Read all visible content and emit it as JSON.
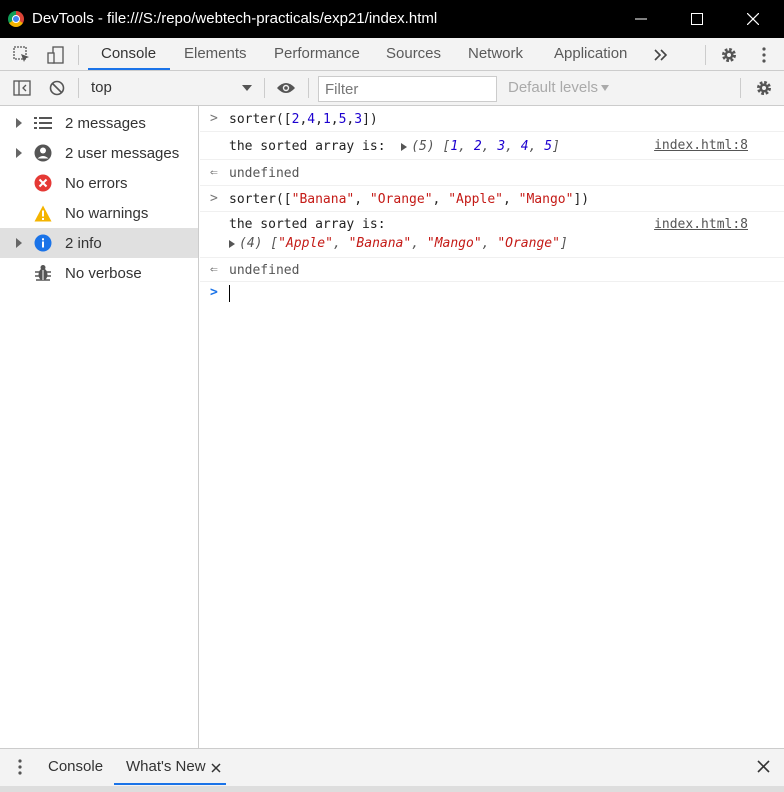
{
  "window": {
    "title": "DevTools - file:///S:/repo/webtech-practicals/exp21/index.html"
  },
  "tabs": [
    {
      "label": "Console",
      "active": true
    },
    {
      "label": "Elements"
    },
    {
      "label": "Performance"
    },
    {
      "label": "Sources"
    },
    {
      "label": "Network"
    },
    {
      "label": "Application"
    }
  ],
  "toolbar": {
    "context": "top",
    "filter_placeholder": "Filter",
    "levels": "Default levels"
  },
  "sidebar": {
    "items": [
      {
        "label": "2 messages",
        "icon": "list-icon"
      },
      {
        "label": "2 user messages",
        "icon": "user-icon"
      },
      {
        "label": "No errors",
        "icon": "error-icon"
      },
      {
        "label": "No warnings",
        "icon": "warning-icon"
      },
      {
        "label": "2 info",
        "icon": "info-icon",
        "selected": true
      },
      {
        "label": "No verbose",
        "icon": "bug-icon"
      }
    ]
  },
  "console": {
    "entries": [
      {
        "type": "input",
        "text": "sorter([2,4,1,5,3])"
      },
      {
        "type": "log",
        "text": "the sorted array is:",
        "preview": "(5) [1, 2, 3, 4, 5]",
        "source": "index.html:8"
      },
      {
        "type": "result",
        "text": "undefined"
      },
      {
        "type": "input",
        "text": "sorter([\"Banana\", \"Orange\", \"Apple\", \"Mango\"])"
      },
      {
        "type": "log",
        "text": "the sorted array is:",
        "preview": "(4) [\"Apple\", \"Banana\", \"Mango\", \"Orange\"]",
        "source": "index.html:8"
      },
      {
        "type": "result",
        "text": "undefined"
      }
    ]
  },
  "drawer": {
    "tabs": [
      {
        "label": "Console"
      },
      {
        "label": "What's New",
        "active": true
      }
    ]
  },
  "colors": {
    "accent": "#1a73e8",
    "number": "#1c00cf",
    "string": "#c41a16"
  }
}
